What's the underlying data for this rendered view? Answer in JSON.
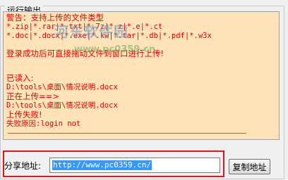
{
  "group": {
    "title": "运行输出"
  },
  "watermark": {
    "site": "河东软件园",
    "url": "www.pc0359.cn"
  },
  "log": {
    "lines": [
      "警告：支持上传的文件类型",
      "*.zip|*.rar|*.txt|*.7z|*.z|*.e|*.ct",
      "*.doc|*.docx|*.exe|*.kw|*.tar|*.db|*.pdf|*.w3x",
      "登录成功后可直接拖动文件到窗口进行上传!",
      "已读入:",
      "D:\\tools\\桌面\\情况说明.docx",
      "正在上传==>",
      "D:\\tools\\桌面\\情况说明.docx",
      "上传失败!",
      "失败原因:login not"
    ]
  },
  "share": {
    "label": "分享地址:",
    "value": "http://www.pc0359.cn/",
    "copy_button": "复制地址"
  },
  "colors": {
    "log_text": "#e00000",
    "log_bg": "#ffe3b8",
    "highlight": "#e8131a",
    "selection": "#3399ff"
  }
}
